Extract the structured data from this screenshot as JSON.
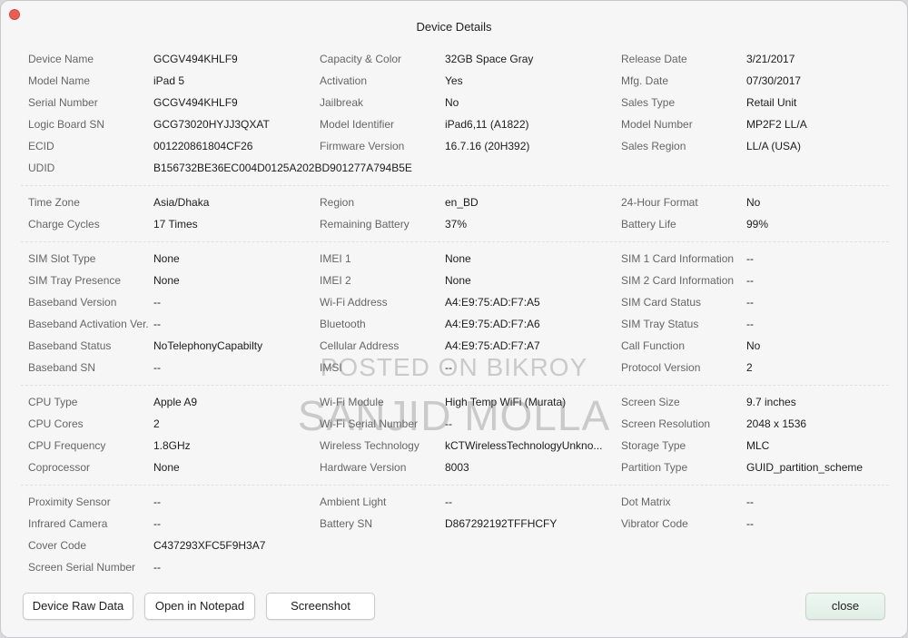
{
  "window": {
    "title": "Device Details"
  },
  "sections": [
    {
      "rows": [
        [
          [
            "Device Name",
            "GCGV494KHLF9"
          ],
          [
            "Capacity & Color",
            "32GB Space Gray"
          ],
          [
            "Release Date",
            "3/21/2017"
          ]
        ],
        [
          [
            "Model Name",
            "iPad 5"
          ],
          [
            "Activation",
            "Yes"
          ],
          [
            "Mfg. Date",
            "07/30/2017"
          ]
        ],
        [
          [
            "Serial Number",
            "GCGV494KHLF9"
          ],
          [
            "Jailbreak",
            "No"
          ],
          [
            "Sales Type",
            "Retail Unit"
          ]
        ],
        [
          [
            "Logic Board SN",
            "GCG73020HYJJ3QXAT"
          ],
          [
            "Model Identifier",
            "iPad6,11 (A1822)"
          ],
          [
            "Model Number",
            "MP2F2 LL/A"
          ]
        ],
        [
          [
            "ECID",
            "001220861804CF26"
          ],
          [
            "Firmware Version",
            "16.7.16 (20H392)"
          ],
          [
            "Sales Region",
            "LL/A (USA)"
          ]
        ],
        [
          [
            "UDID",
            "B156732BE36EC004D0125A202BD901277A794B5E"
          ]
        ]
      ]
    },
    {
      "rows": [
        [
          [
            "Time Zone",
            "Asia/Dhaka"
          ],
          [
            "Region",
            "en_BD"
          ],
          [
            "24-Hour Format",
            "No"
          ]
        ],
        [
          [
            "Charge Cycles",
            "17 Times"
          ],
          [
            "Remaining Battery",
            "37%"
          ],
          [
            "Battery Life",
            "99%"
          ]
        ]
      ]
    },
    {
      "rows": [
        [
          [
            "SIM Slot Type",
            "None"
          ],
          [
            "IMEI 1",
            "None"
          ],
          [
            "SIM 1 Card Information",
            "--"
          ]
        ],
        [
          [
            "SIM Tray Presence",
            "None"
          ],
          [
            "IMEI 2",
            "None"
          ],
          [
            "SIM 2 Card Information",
            "--"
          ]
        ],
        [
          [
            "Baseband Version",
            "--"
          ],
          [
            "Wi-Fi Address",
            "A4:E9:75:AD:F7:A5"
          ],
          [
            "SIM Card Status",
            "--"
          ]
        ],
        [
          [
            "Baseband Activation Ver.",
            "--"
          ],
          [
            "Bluetooth",
            "A4:E9:75:AD:F7:A6"
          ],
          [
            "SIM Tray Status",
            "--"
          ]
        ],
        [
          [
            "Baseband Status",
            "NoTelephonyCapabilty"
          ],
          [
            "Cellular Address",
            "A4:E9:75:AD:F7:A7"
          ],
          [
            "Call Function",
            "No"
          ]
        ],
        [
          [
            "Baseband SN",
            "--"
          ],
          [
            "IMSI",
            "--"
          ],
          [
            "Protocol Version",
            "2"
          ]
        ]
      ]
    },
    {
      "rows": [
        [
          [
            "CPU Type",
            "Apple A9"
          ],
          [
            "Wi-Fi Module",
            "High Temp WiFi (Murata)"
          ],
          [
            "Screen Size",
            "9.7 inches"
          ]
        ],
        [
          [
            "CPU Cores",
            "2"
          ],
          [
            "Wi-Fi Serial Number",
            "--"
          ],
          [
            "Screen Resolution",
            "2048 x 1536"
          ]
        ],
        [
          [
            "CPU Frequency",
            "1.8GHz"
          ],
          [
            "Wireless Technology",
            "kCTWirelessTechnologyUnkno..."
          ],
          [
            "Storage Type",
            "MLC"
          ]
        ],
        [
          [
            "Coprocessor",
            "None"
          ],
          [
            "Hardware Version",
            "8003"
          ],
          [
            "Partition Type",
            "GUID_partition_scheme"
          ]
        ]
      ]
    },
    {
      "rows": [
        [
          [
            "Proximity Sensor",
            "--"
          ],
          [
            "Ambient Light",
            "--"
          ],
          [
            "Dot Matrix",
            "--"
          ]
        ],
        [
          [
            "Infrared Camera",
            "--"
          ],
          [
            "Battery SN",
            "D867292192TFFHCFY"
          ],
          [
            "Vibrator Code",
            "--"
          ]
        ],
        [
          [
            "Cover Code",
            "C437293XFC5F9H3A7"
          ]
        ],
        [
          [
            "Screen Serial Number",
            "--"
          ]
        ]
      ]
    }
  ],
  "buttons": {
    "raw_data": "Device Raw Data",
    "notepad": "Open in Notepad",
    "screenshot": "Screenshot",
    "close": "close"
  },
  "watermark": {
    "line1": "POSTED ON BIKROY",
    "line2": "SANJID MOLLA"
  },
  "colors": {
    "close_dot": "#ee5b56",
    "close_button": "#e0efe6"
  }
}
